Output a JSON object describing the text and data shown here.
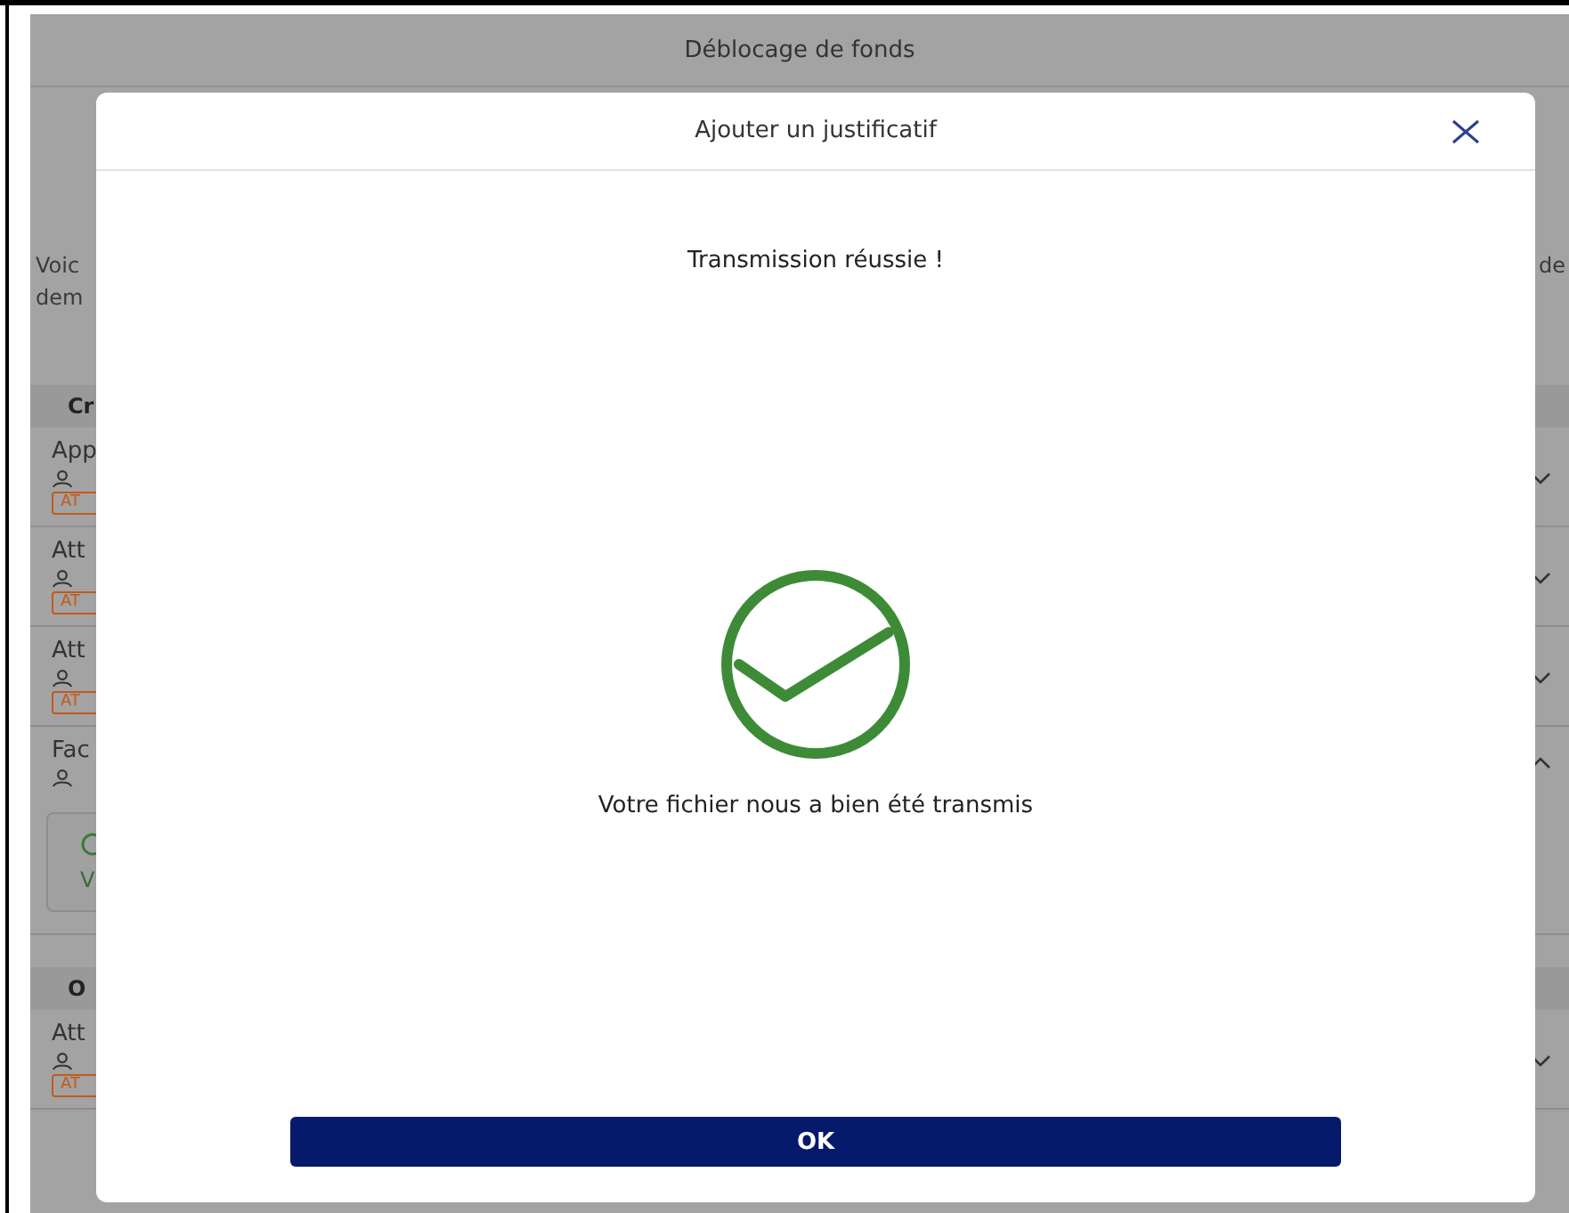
{
  "page": {
    "title": "Déblocage de fonds",
    "intro_left": [
      "Voic",
      "dem"
    ],
    "intro_right": "de",
    "sections": [
      {
        "title": "Cr",
        "items": [
          {
            "title": "App",
            "badge": "AT",
            "expanded": false
          },
          {
            "title": "Att",
            "badge": "AT",
            "expanded": false
          },
          {
            "title": "Att",
            "badge": "AT",
            "expanded": false
          },
          {
            "title": "Fac",
            "expanded": true,
            "card_text": "V"
          }
        ]
      },
      {
        "title": "O",
        "items": [
          {
            "title": "Att",
            "badge": "AT",
            "expanded": false
          }
        ]
      }
    ]
  },
  "modal": {
    "title": "Ajouter un justificatif",
    "heading": "Transmission réussie !",
    "message": "Votre fichier nous a bien été transmis",
    "button": "OK"
  }
}
